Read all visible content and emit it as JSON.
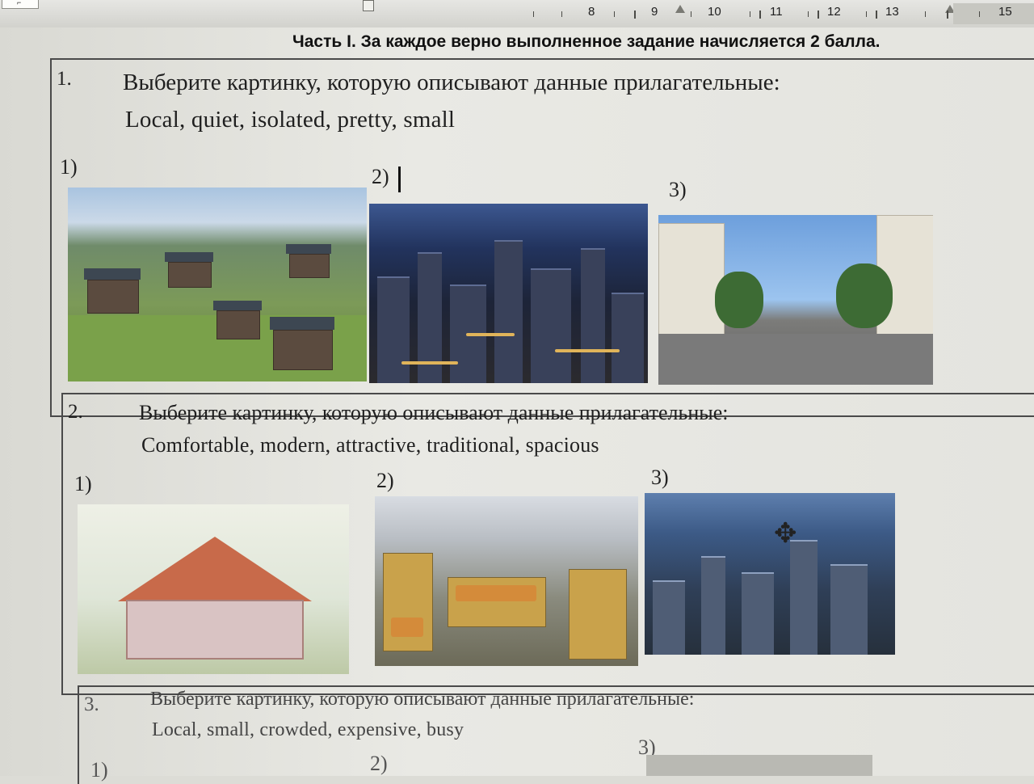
{
  "ruler": {
    "corner_symbol": "⌐",
    "numbers": [
      "8",
      "9",
      "10",
      "11",
      "12",
      "13",
      "15"
    ]
  },
  "document": {
    "part_heading": "Часть I. За каждое верно выполненное задание начисляется 2 балла.",
    "questions": [
      {
        "number": "1.",
        "prompt": "Выберите картинку, которую описывают данные прилагательные:",
        "adjectives": "Local, quiet, isolated, pretty, small",
        "options": [
          "1)",
          "2)",
          "3)"
        ],
        "images": [
          "village-photo",
          "night-city-photo",
          "street-photo"
        ]
      },
      {
        "number": "2.",
        "prompt": "Выберите картинку, которую описывают данные прилагательные:",
        "adjectives": "Comfortable, modern, attractive, traditional, spacious",
        "options": [
          "1)",
          "2)",
          "3)"
        ],
        "images": [
          "cottage-drawing",
          "market-photo",
          "city-skyline-photo"
        ]
      },
      {
        "number": "3.",
        "prompt": "Выберите картинку, которую описывают данные прилагательные:",
        "adjectives": "Local, small,  crowded, expensive, busy",
        "options": [
          "1)",
          "2)",
          "3)"
        ]
      }
    ]
  },
  "cursor": {
    "icon": "move-cursor-icon"
  },
  "colors": {
    "paper": "#e9e9e4",
    "text": "#1f1f1f",
    "border": "#4a4a4a"
  }
}
